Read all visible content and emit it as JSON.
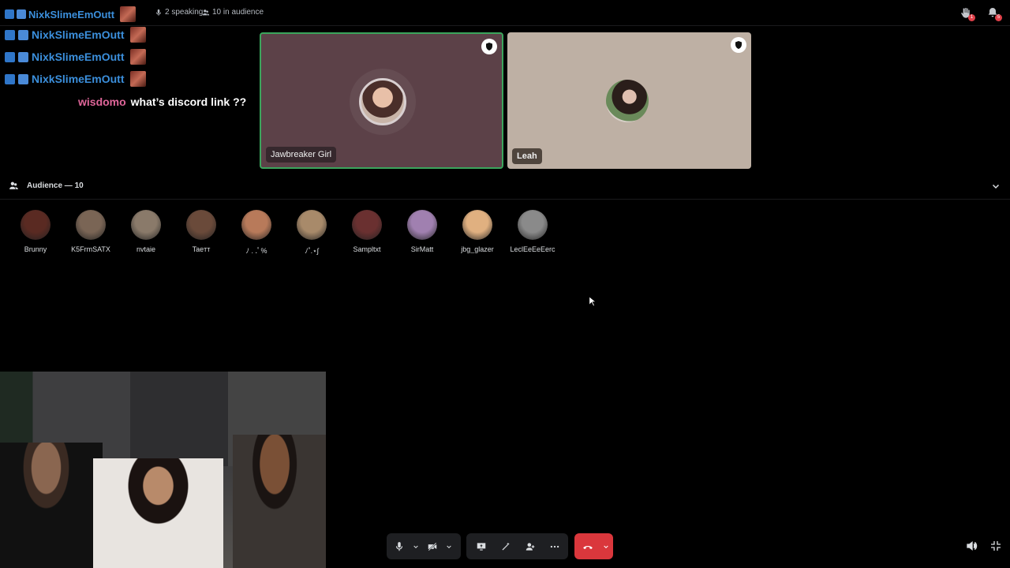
{
  "header": {
    "channel_name": "NixkSlimeEmOutt",
    "speaking_count": "2 speaking",
    "audience_count": "10 in audience",
    "raise_hand_badge": "1",
    "notification_badge": "5"
  },
  "chat": {
    "repeated_messages": [
      {
        "name": "NixkSlimeEmOutt"
      },
      {
        "name": "NixkSlimeEmOutt"
      },
      {
        "name": "NixkSlimeEmOutt"
      }
    ],
    "message": {
      "name": "wisdomo",
      "text": "what’s discord link ??",
      "name_color": "#e0669a"
    }
  },
  "speakers": [
    {
      "name": "Jawbreaker Girl",
      "bg": "#5c4148",
      "active": true
    },
    {
      "name": "Leah",
      "bg": "#beb0a4",
      "active": false
    }
  ],
  "audience": {
    "title": "Audience — 10",
    "members": [
      {
        "name": "Brunny",
        "color": "#5a2a22"
      },
      {
        "name": "K5FrmSATX",
        "color": "#7a6555"
      },
      {
        "name": "nvtaie",
        "color": "#8a7a6a"
      },
      {
        "name": "Taeтт",
        "color": "#6a4a3a"
      },
      {
        "name": "ﾉ . .ﾟ%",
        "color": "#b87a5a"
      },
      {
        "name": "ﾉ˚.⋆ʃ",
        "color": "#a88a6a"
      },
      {
        "name": "Sampltxt",
        "color": "#6a3030"
      },
      {
        "name": "SirMatt",
        "color": "#a080b0"
      },
      {
        "name": "jbg_glazer",
        "color": "#e0b080"
      },
      {
        "name": "LeclEeEeEerc",
        "color": "#8a8a8a"
      }
    ]
  },
  "colors": {
    "accent_blue": "#3b8fdc",
    "active_border": "#3ba55c",
    "disconnect_red": "#da373c",
    "control_bg": "#1e1f22"
  }
}
